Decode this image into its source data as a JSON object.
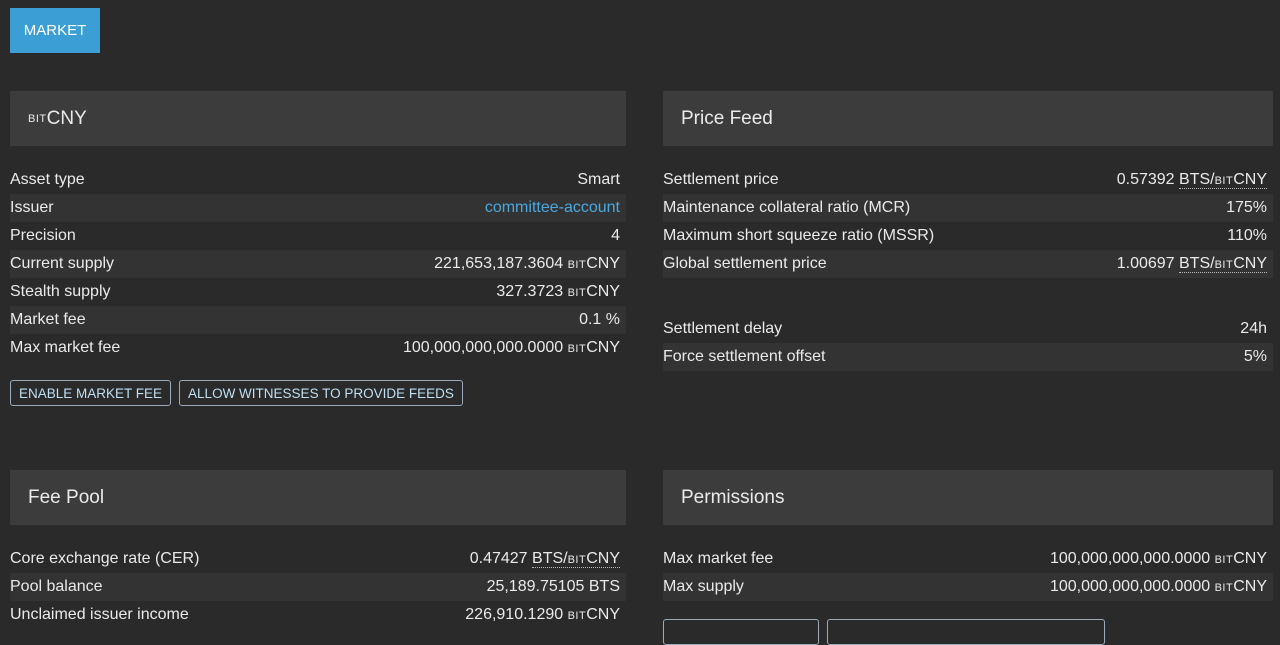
{
  "market_button": "MARKET",
  "asset_panel": {
    "title_prefix": "BIT",
    "title": "CNY",
    "rows": [
      {
        "label": "Asset type",
        "value": "Smart"
      },
      {
        "label": "Issuer",
        "value": "committee-account"
      },
      {
        "label": "Precision",
        "value": "4"
      },
      {
        "label": "Current supply",
        "value": "221,653,187.3604",
        "unit_prefix": "BIT",
        "unit": "CNY"
      },
      {
        "label": "Stealth supply",
        "value": "327.3723",
        "unit_prefix": "BIT",
        "unit": "CNY"
      },
      {
        "label": "Market fee",
        "value": "0.1 %"
      },
      {
        "label": "Max market fee",
        "value": "100,000,000,000.0000",
        "unit_prefix": "BIT",
        "unit": "CNY"
      }
    ],
    "buttons": [
      "ENABLE MARKET FEE",
      "ALLOW WITNESSES TO PROVIDE FEEDS"
    ]
  },
  "price_feed": {
    "title": "Price Feed",
    "rows": [
      {
        "label": "Settlement price",
        "value": "0.57392",
        "unit": "BTS/",
        "unit_prefix": "BIT",
        "unit2": "CNY"
      },
      {
        "label": "Maintenance collateral ratio (MCR)",
        "value": "175%"
      },
      {
        "label": "Maximum short squeeze ratio (MSSR)",
        "value": "110%"
      },
      {
        "label": "Global settlement price",
        "value": "1.00697",
        "unit": "BTS/",
        "unit_prefix": "BIT",
        "unit2": "CNY"
      }
    ],
    "rows2": [
      {
        "label": "Settlement delay",
        "value": "24h"
      },
      {
        "label": "Force settlement offset",
        "value": "5%"
      }
    ]
  },
  "fee_pool": {
    "title": "Fee Pool",
    "rows": [
      {
        "label": "Core exchange rate (CER)",
        "value": "0.47427",
        "unit": "BTS/",
        "unit_prefix": "BIT",
        "unit2": "CNY"
      },
      {
        "label": "Pool balance",
        "value": "25,189.75105 BTS"
      },
      {
        "label": "Unclaimed issuer income",
        "value": "226,910.1290",
        "unit_prefix": "BIT",
        "unit": "CNY"
      }
    ]
  },
  "permissions": {
    "title": "Permissions",
    "rows": [
      {
        "label": "Max market fee",
        "value": "100,000,000,000.0000",
        "unit_prefix": "BIT",
        "unit": "CNY"
      },
      {
        "label": "Max supply",
        "value": "100,000,000,000.0000",
        "unit_prefix": "BIT",
        "unit": "CNY"
      }
    ]
  }
}
